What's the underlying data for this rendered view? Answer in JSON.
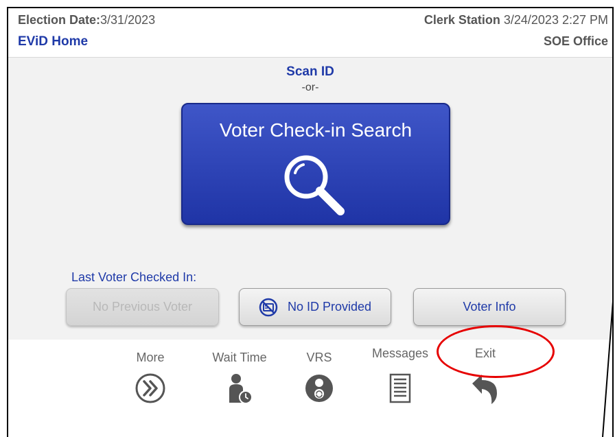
{
  "header": {
    "election_date_label": "Election Date:",
    "election_date_value": "3/31/2023",
    "page_title": "EViD Home",
    "station_label": "Clerk Station",
    "station_datetime": "3/24/2023 2:27 PM",
    "office": "SOE Office"
  },
  "main": {
    "scan_id": "Scan ID",
    "or_text": "-or-",
    "search_button_label": "Voter Check-in Search",
    "last_voter_label": "Last Voter Checked In:",
    "no_previous_voter_label": "No Previous Voter",
    "no_id_provided_label": "No ID Provided",
    "voter_info_label": "Voter Info"
  },
  "footer": {
    "more_label": "More",
    "wait_time_label": "Wait Time",
    "vrs_label": "VRS",
    "messages_label": "Messages",
    "exit_label": "Exit"
  },
  "icons": {
    "search": "magnifier-icon",
    "no_id": "no-id-card-icon",
    "more": "double-chevron-right-icon",
    "wait_time": "person-clock-icon",
    "vrs": "person-sync-icon",
    "messages": "document-lines-icon",
    "exit": "curved-back-arrow-icon"
  },
  "colors": {
    "primary_blue": "#1f3aa8",
    "button_blue": "#2a40b5",
    "annotation_red": "#e60000",
    "icon_gray": "#555555"
  }
}
